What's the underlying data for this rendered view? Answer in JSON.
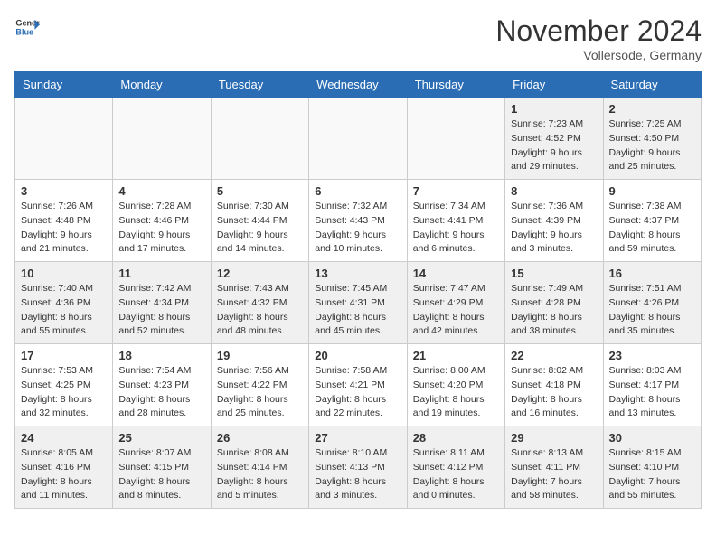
{
  "logo": {
    "general": "General",
    "blue": "Blue"
  },
  "title": "November 2024",
  "location": "Vollersode, Germany",
  "days_of_week": [
    "Sunday",
    "Monday",
    "Tuesday",
    "Wednesday",
    "Thursday",
    "Friday",
    "Saturday"
  ],
  "weeks": [
    [
      {
        "day": "",
        "info": "",
        "empty": true
      },
      {
        "day": "",
        "info": "",
        "empty": true
      },
      {
        "day": "",
        "info": "",
        "empty": true
      },
      {
        "day": "",
        "info": "",
        "empty": true
      },
      {
        "day": "",
        "info": "",
        "empty": true
      },
      {
        "day": "1",
        "info": "Sunrise: 7:23 AM\nSunset: 4:52 PM\nDaylight: 9 hours\nand 29 minutes."
      },
      {
        "day": "2",
        "info": "Sunrise: 7:25 AM\nSunset: 4:50 PM\nDaylight: 9 hours\nand 25 minutes."
      }
    ],
    [
      {
        "day": "3",
        "info": "Sunrise: 7:26 AM\nSunset: 4:48 PM\nDaylight: 9 hours\nand 21 minutes."
      },
      {
        "day": "4",
        "info": "Sunrise: 7:28 AM\nSunset: 4:46 PM\nDaylight: 9 hours\nand 17 minutes."
      },
      {
        "day": "5",
        "info": "Sunrise: 7:30 AM\nSunset: 4:44 PM\nDaylight: 9 hours\nand 14 minutes."
      },
      {
        "day": "6",
        "info": "Sunrise: 7:32 AM\nSunset: 4:43 PM\nDaylight: 9 hours\nand 10 minutes."
      },
      {
        "day": "7",
        "info": "Sunrise: 7:34 AM\nSunset: 4:41 PM\nDaylight: 9 hours\nand 6 minutes."
      },
      {
        "day": "8",
        "info": "Sunrise: 7:36 AM\nSunset: 4:39 PM\nDaylight: 9 hours\nand 3 minutes."
      },
      {
        "day": "9",
        "info": "Sunrise: 7:38 AM\nSunset: 4:37 PM\nDaylight: 8 hours\nand 59 minutes."
      }
    ],
    [
      {
        "day": "10",
        "info": "Sunrise: 7:40 AM\nSunset: 4:36 PM\nDaylight: 8 hours\nand 55 minutes."
      },
      {
        "day": "11",
        "info": "Sunrise: 7:42 AM\nSunset: 4:34 PM\nDaylight: 8 hours\nand 52 minutes."
      },
      {
        "day": "12",
        "info": "Sunrise: 7:43 AM\nSunset: 4:32 PM\nDaylight: 8 hours\nand 48 minutes."
      },
      {
        "day": "13",
        "info": "Sunrise: 7:45 AM\nSunset: 4:31 PM\nDaylight: 8 hours\nand 45 minutes."
      },
      {
        "day": "14",
        "info": "Sunrise: 7:47 AM\nSunset: 4:29 PM\nDaylight: 8 hours\nand 42 minutes."
      },
      {
        "day": "15",
        "info": "Sunrise: 7:49 AM\nSunset: 4:28 PM\nDaylight: 8 hours\nand 38 minutes."
      },
      {
        "day": "16",
        "info": "Sunrise: 7:51 AM\nSunset: 4:26 PM\nDaylight: 8 hours\nand 35 minutes."
      }
    ],
    [
      {
        "day": "17",
        "info": "Sunrise: 7:53 AM\nSunset: 4:25 PM\nDaylight: 8 hours\nand 32 minutes."
      },
      {
        "day": "18",
        "info": "Sunrise: 7:54 AM\nSunset: 4:23 PM\nDaylight: 8 hours\nand 28 minutes."
      },
      {
        "day": "19",
        "info": "Sunrise: 7:56 AM\nSunset: 4:22 PM\nDaylight: 8 hours\nand 25 minutes."
      },
      {
        "day": "20",
        "info": "Sunrise: 7:58 AM\nSunset: 4:21 PM\nDaylight: 8 hours\nand 22 minutes."
      },
      {
        "day": "21",
        "info": "Sunrise: 8:00 AM\nSunset: 4:20 PM\nDaylight: 8 hours\nand 19 minutes."
      },
      {
        "day": "22",
        "info": "Sunrise: 8:02 AM\nSunset: 4:18 PM\nDaylight: 8 hours\nand 16 minutes."
      },
      {
        "day": "23",
        "info": "Sunrise: 8:03 AM\nSunset: 4:17 PM\nDaylight: 8 hours\nand 13 minutes."
      }
    ],
    [
      {
        "day": "24",
        "info": "Sunrise: 8:05 AM\nSunset: 4:16 PM\nDaylight: 8 hours\nand 11 minutes."
      },
      {
        "day": "25",
        "info": "Sunrise: 8:07 AM\nSunset: 4:15 PM\nDaylight: 8 hours\nand 8 minutes."
      },
      {
        "day": "26",
        "info": "Sunrise: 8:08 AM\nSunset: 4:14 PM\nDaylight: 8 hours\nand 5 minutes."
      },
      {
        "day": "27",
        "info": "Sunrise: 8:10 AM\nSunset: 4:13 PM\nDaylight: 8 hours\nand 3 minutes."
      },
      {
        "day": "28",
        "info": "Sunrise: 8:11 AM\nSunset: 4:12 PM\nDaylight: 8 hours\nand 0 minutes."
      },
      {
        "day": "29",
        "info": "Sunrise: 8:13 AM\nSunset: 4:11 PM\nDaylight: 7 hours\nand 58 minutes."
      },
      {
        "day": "30",
        "info": "Sunrise: 8:15 AM\nSunset: 4:10 PM\nDaylight: 7 hours\nand 55 minutes."
      }
    ]
  ]
}
